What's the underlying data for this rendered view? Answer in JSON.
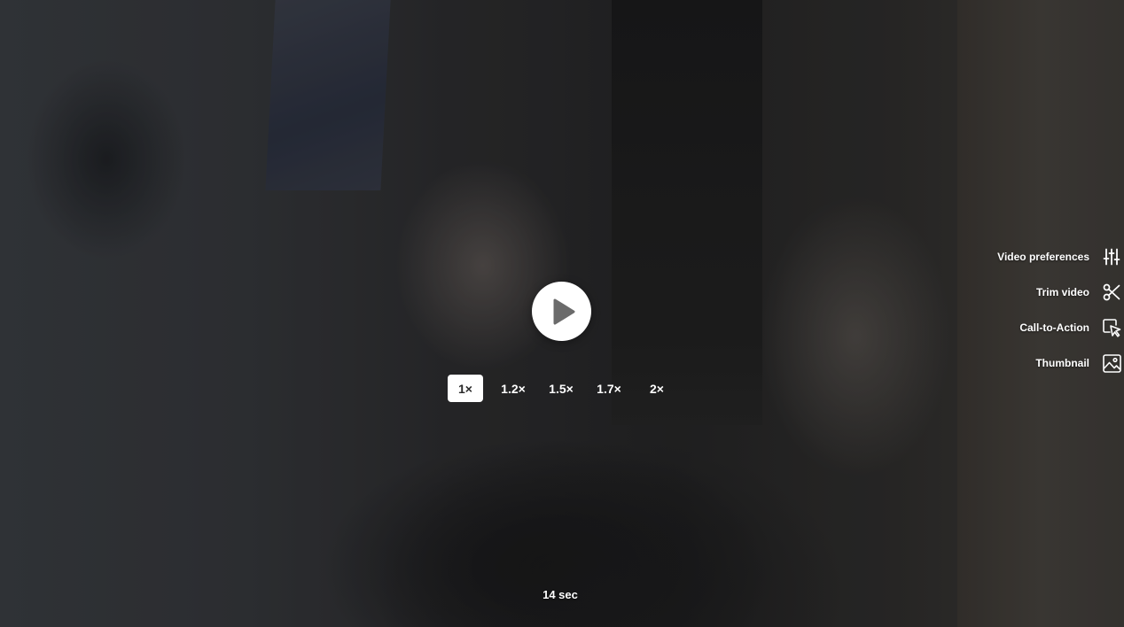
{
  "player": {
    "play_icon": "play-icon",
    "duration_label": "14 sec"
  },
  "speed": {
    "options": [
      "1×",
      "1.2×",
      "1.5×",
      "1.7×",
      "2×"
    ],
    "selected": "1×"
  },
  "side_actions": [
    {
      "label": "Video preferences",
      "icon": "sliders-icon"
    },
    {
      "label": "Trim video",
      "icon": "scissors-icon"
    },
    {
      "label": "Call-to-Action",
      "icon": "cursor-click-icon"
    },
    {
      "label": "Thumbnail",
      "icon": "image-icon"
    }
  ],
  "colors": {
    "overlay_text": "#ffffff",
    "selected_speed_bg": "#ffffff",
    "selected_speed_text": "#2a2a2a",
    "play_button_bg": "#ffffff",
    "play_glyph": "#6b6b6b"
  }
}
